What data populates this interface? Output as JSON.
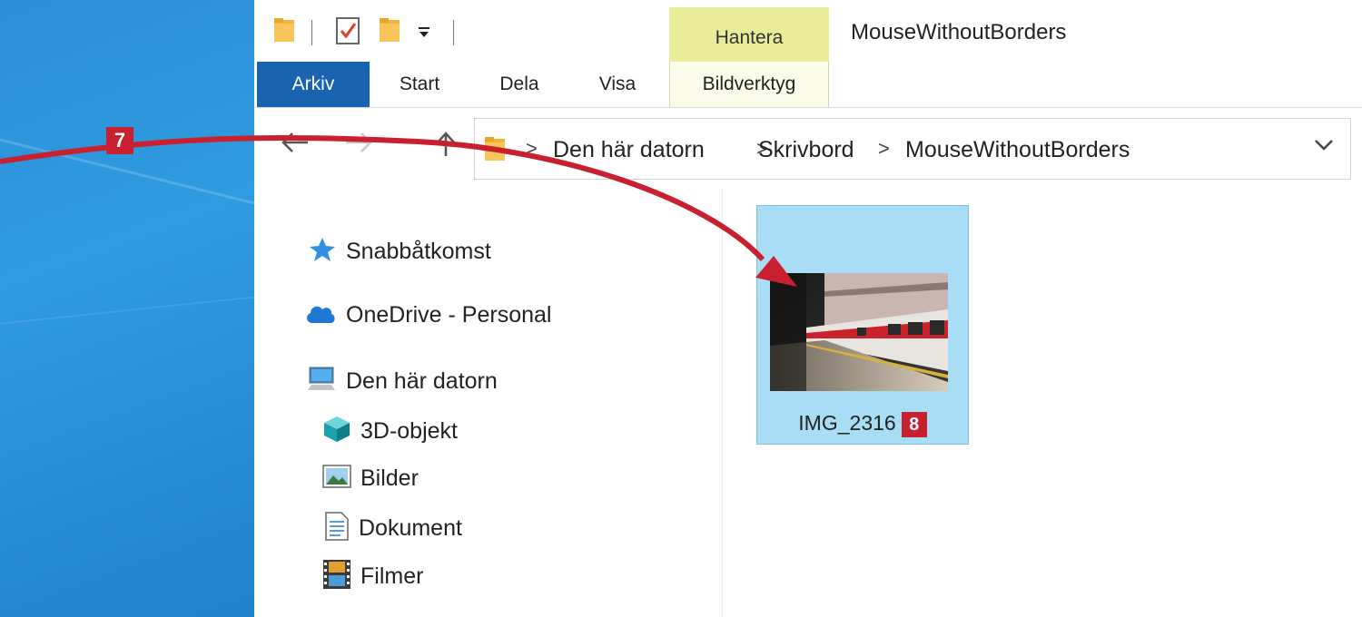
{
  "window": {
    "title": "MouseWithoutBorders"
  },
  "ribbon": {
    "context_group_label": "Hantera",
    "tabs": [
      {
        "label": "Arkiv",
        "active": true
      },
      {
        "label": "Start"
      },
      {
        "label": "Dela"
      },
      {
        "label": "Visa"
      },
      {
        "label": "Bildverktyg",
        "contextual": true
      }
    ]
  },
  "quick_access_toolbar": {
    "icons": [
      "folder-icon",
      "properties-checkmark-icon",
      "new-folder-icon",
      "customize-dropdown-icon"
    ]
  },
  "navigation": {
    "back_icon": "arrow-left-icon",
    "forward_icon": "arrow-right-icon",
    "up_icon": "arrow-up-icon"
  },
  "address_bar": {
    "breadcrumbs": [
      "Den här datorn",
      "Skrivbord",
      "MouseWithoutBorders"
    ],
    "separator": ">"
  },
  "nav_pane": {
    "items": [
      {
        "label": "Snabbåtkomst",
        "icon": "star-icon"
      },
      {
        "label": "OneDrive - Personal",
        "icon": "cloud-icon"
      },
      {
        "label": "Den här datorn",
        "icon": "computer-icon"
      },
      {
        "label": "3D-objekt",
        "icon": "cube-icon"
      },
      {
        "label": "Bilder",
        "icon": "pictures-icon"
      },
      {
        "label": "Dokument",
        "icon": "document-icon"
      },
      {
        "label": "Filmer",
        "icon": "film-icon"
      }
    ]
  },
  "content": {
    "files": [
      {
        "name": "IMG_2316",
        "selected": true
      }
    ]
  },
  "callouts": {
    "step_7": "7",
    "step_8": "8"
  },
  "colors": {
    "accent": "#1a63b0",
    "context_tab": "#e9ec98",
    "selection": "#a9dcf5",
    "callout": "#c8202f",
    "desktop": "#2a8fd6"
  }
}
